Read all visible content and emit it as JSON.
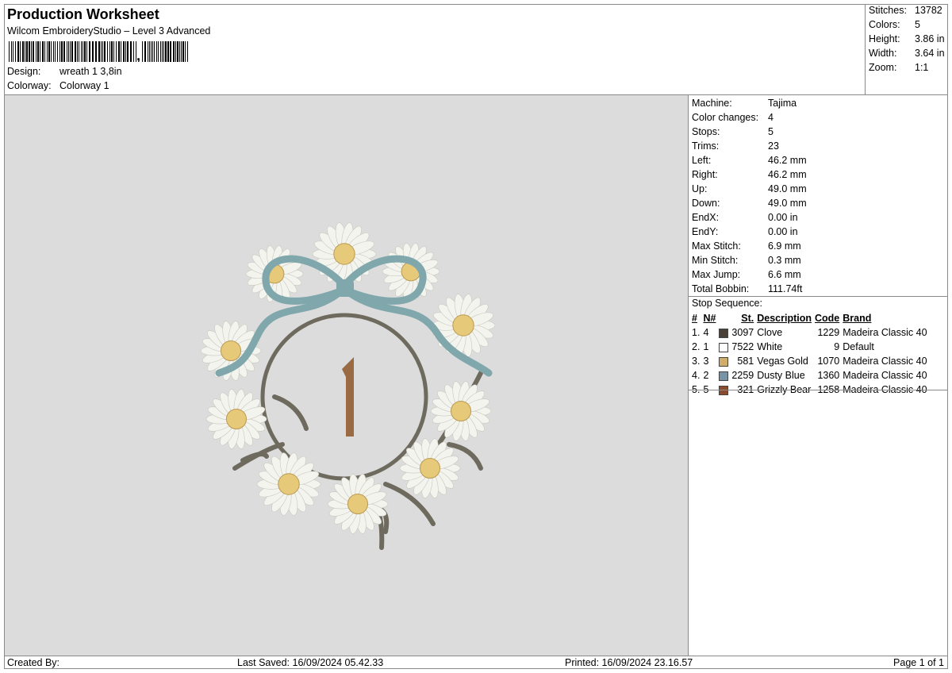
{
  "header": {
    "title": "Production Worksheet",
    "subtitle": "Wilcom EmbroideryStudio – Level 3 Advanced",
    "design_label": "Design:",
    "design_value": "wreath 1 3,8in",
    "colorway_label": "Colorway:",
    "colorway_value": "Colorway 1"
  },
  "stats": [
    {
      "label": "Stitches:",
      "value": "13782"
    },
    {
      "label": "Colors:",
      "value": "5"
    },
    {
      "label": "Height:",
      "value": "3.86 in"
    },
    {
      "label": "Width:",
      "value": "3.64 in"
    },
    {
      "label": "Zoom:",
      "value": "1:1"
    }
  ],
  "machine": [
    {
      "label": "Machine:",
      "value": "Tajima"
    },
    {
      "label": "Color changes:",
      "value": "4"
    },
    {
      "label": "Stops:",
      "value": "5"
    },
    {
      "label": "Trims:",
      "value": "23"
    },
    {
      "label": "Left:",
      "value": "46.2 mm"
    },
    {
      "label": "Right:",
      "value": "46.2 mm"
    },
    {
      "label": "Up:",
      "value": "49.0 mm"
    },
    {
      "label": "Down:",
      "value": "49.0 mm"
    },
    {
      "label": "EndX:",
      "value": "0.00 in"
    },
    {
      "label": "EndY:",
      "value": "0.00 in"
    },
    {
      "label": "Max Stitch:",
      "value": "6.9 mm"
    },
    {
      "label": "Min Stitch:",
      "value": "0.3 mm"
    },
    {
      "label": "Max Jump:",
      "value": "6.6 mm"
    },
    {
      "label": "Total Bobbin:",
      "value": "111.74ft"
    }
  ],
  "sequence": {
    "title": "Stop Sequence:",
    "headers": [
      "#",
      "N#",
      "St.",
      "Description",
      "Code",
      "Brand"
    ],
    "rows": [
      {
        "idx": "1.",
        "n": "4",
        "color": "#4a4136",
        "st": "3097",
        "desc": "Clove",
        "code": "1229",
        "brand": "Madeira Classic 40"
      },
      {
        "idx": "2.",
        "n": "1",
        "color": "#ffffff",
        "st": "7522",
        "desc": "White",
        "code": "9",
        "brand": "Default"
      },
      {
        "idx": "3.",
        "n": "3",
        "color": "#d1ad6a",
        "st": "581",
        "desc": "Vegas Gold",
        "code": "1070",
        "brand": "Madeira Classic 40"
      },
      {
        "idx": "4.",
        "n": "2",
        "color": "#7893a3",
        "st": "2259",
        "desc": "Dusty Blue",
        "code": "1360",
        "brand": "Madeira Classic 40"
      },
      {
        "idx": "5.",
        "n": "5",
        "color": "#8c4a2c",
        "st": "321",
        "desc": "Grizzly Bear",
        "code": "1258",
        "brand": "Madeira Classic 40"
      }
    ]
  },
  "footer": {
    "created_by": "Created By:",
    "last_saved": "Last Saved: 16/09/2024 05.42.33",
    "printed": "Printed: 16/09/2024 23.16.57",
    "page": "Page 1 of 1"
  },
  "design_preview": {
    "numeral": "1",
    "colors": {
      "stem": "#6e6a5e",
      "petal": "#f4f4ee",
      "center": "#e7c97a",
      "ribbon": "#7fa7ac",
      "numeral": "#9a6a43"
    }
  }
}
